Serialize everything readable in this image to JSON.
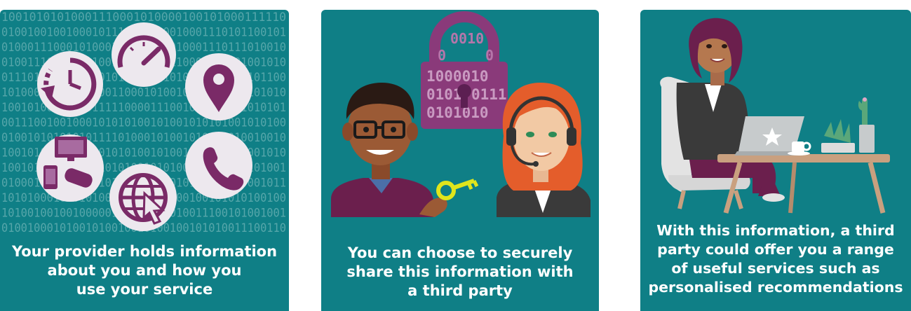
{
  "cards": [
    {
      "caption_lines": [
        "Your provider holds information",
        "about you and how you",
        "use your service"
      ],
      "binary_rows": [
        "10010101010001110001010000100101000111110",
        "01001001001000101110101100010001110101100101",
        "01000111000101000110001101010001110111010010",
        "01001110001011100100100010110001010101001010",
        "01110111000110001010101001010101101000101100",
        "10100001011010100110001010010101001010101010",
        "10010100101010111110000111001010100101010101",
        "00111001001000101010100101001010101001010100",
        "01001010101010111101000101001010010010010010",
        "10010100100101001010100101001010100101001010",
        "10010101001001010101001010100100101010101001",
        "01000101010001010100101010010100101000001011",
        "10101000101010100101010101000100101010100100",
        "10100100100100000100101010010011100101001001",
        "01001000101001010010010100100101010011100110"
      ],
      "colors": {
        "background": "#0f7f86",
        "digits": "#6fb3b6",
        "icon_bg": "#ede8ee",
        "icon": "#7a2a67"
      }
    },
    {
      "caption_lines": [
        "You can choose to securely",
        "share this information with",
        "a third party"
      ],
      "lock_lines": [
        "0010",
        "0",
        "0",
        "1000010",
        "0101",
        "0111",
        "0101010"
      ],
      "colors": {
        "background": "#0f7f86",
        "lock": "#8a3a7a",
        "key": "#e0e51c"
      }
    },
    {
      "caption_lines": [
        "With this information, a third",
        "party could offer you a range",
        "of useful services such as",
        "personalised recommendations"
      ],
      "colors": {
        "background": "#0f7f86",
        "chair": "#e3e3e3",
        "table": "#c9a07f",
        "laptop": "#c7cbcc"
      }
    }
  ]
}
